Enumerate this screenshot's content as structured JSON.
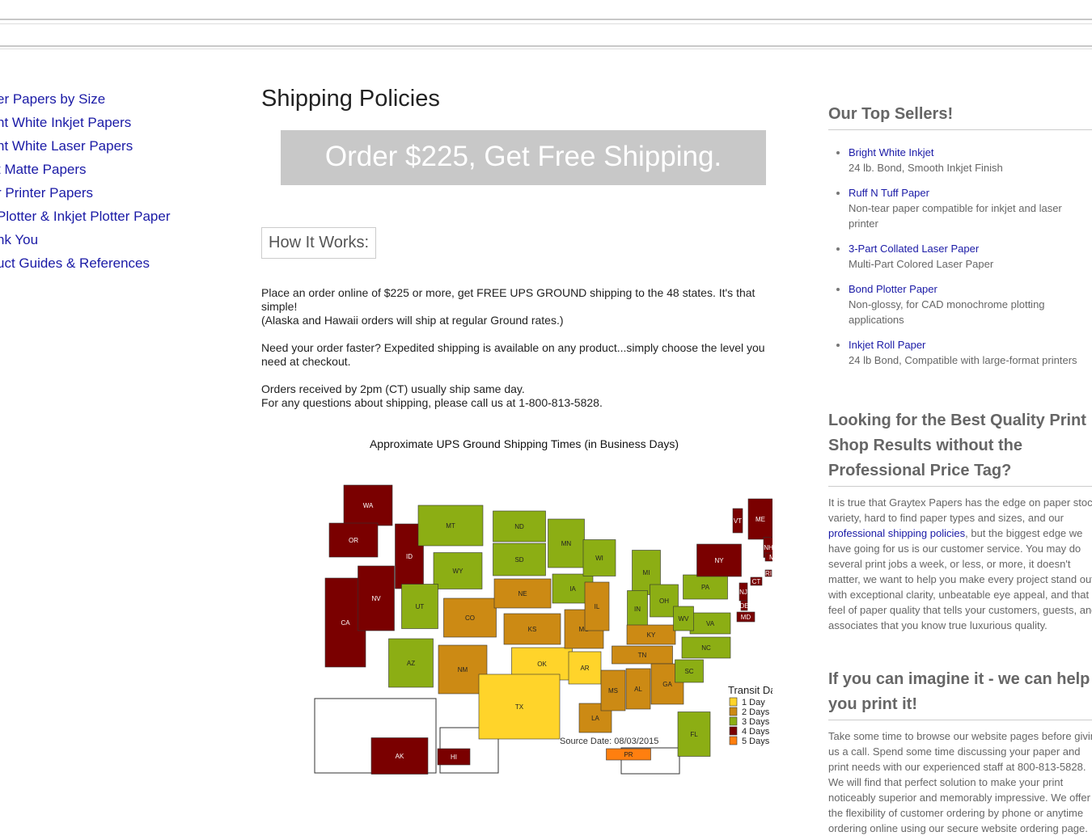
{
  "nav": {
    "items": [
      "er Papers by Size",
      "nt White Inkjet Papers",
      "nt White Laser Papers",
      "t Matte Papers",
      "r Printer Papers",
      "Plotter & Inkjet Plotter Paper",
      "nk You",
      "uct Guides & References"
    ]
  },
  "main": {
    "title": "Shipping Policies",
    "promo": "Order $225, Get Free Shipping.",
    "how_label": "How It Works:",
    "paragraphs": [
      [
        "Place an order online of $225 or more, get FREE UPS GROUND shipping to the 48 states. It's that simple!",
        "(Alaska and Hawaii orders will ship at regular Ground rates.)"
      ],
      [
        "Need your order faster? Expedited shipping is available on any product...simply choose the level you need at checkout."
      ],
      [
        "Orders received by 2pm (CT) usually ship same day.",
        "For any questions about shipping, please call us at 1-800-813-5828."
      ]
    ],
    "map": {
      "title": "Approximate UPS Ground Shipping Times (in Business Days)",
      "source": "Source Date: 08/03/2015",
      "legend_title": "Transit Days",
      "legend": [
        {
          "label": "1 Day",
          "color": "#ffd42a"
        },
        {
          "label": "2 Days",
          "color": "#cc8a14"
        },
        {
          "label": "3 Days",
          "color": "#8cae14"
        },
        {
          "label": "4 Days",
          "color": "#7a0000"
        },
        {
          "label": "5 Days",
          "color": "#ff7f0f"
        }
      ],
      "states": {
        "WA": 4,
        "OR": 4,
        "CA": 4,
        "NV": 4,
        "ID": 4,
        "MT": 3,
        "WY": 3,
        "UT": 3,
        "CO": 2,
        "AZ": 3,
        "NM": 2,
        "ND": 3,
        "SD": 3,
        "NE": 2,
        "KS": 2,
        "OK": 1,
        "TX": 1,
        "MN": 3,
        "IA": 3,
        "MO": 2,
        "AR": 1,
        "LA": 2,
        "WI": 3,
        "IL": 2,
        "MI": 3,
        "IN": 3,
        "OH": 3,
        "KY": 2,
        "TN": 2,
        "MS": 2,
        "AL": 2,
        "GA": 2,
        "FL": 3,
        "SC": 3,
        "NC": 3,
        "VA": 3,
        "WV": 3,
        "PA": 3,
        "NY": 4,
        "VT": 4,
        "ME": 4,
        "NH": 4,
        "MA": 4,
        "RI": 4,
        "CT": 4,
        "NJ": 4,
        "DE": 4,
        "MD": 4,
        "AK": 4,
        "HI": 4,
        "PR": 5
      }
    }
  },
  "side": {
    "top_title": "Our Top Sellers!",
    "top": [
      {
        "name": "Bright White Inkjet",
        "desc": "24 lb. Bond, Smooth Inkjet Finish"
      },
      {
        "name": "Ruff N Tuff Paper",
        "desc": "Non-tear paper compatible for inkjet and laser printer"
      },
      {
        "name": "3-Part Collated Laser Paper",
        "desc": "Multi-Part Colored Laser Paper"
      },
      {
        "name": "Bond Plotter Paper",
        "desc": "Non-glossy, for CAD monochrome plotting applications"
      },
      {
        "name": "Inkjet Roll Paper",
        "desc": "24 lb Bond, Compatible with large-format printers"
      }
    ],
    "h2": "Looking for the Best Quality Print Shop Results without the Professional Price Tag?",
    "p2a": "It is true that Graytex Papers has the edge on paper stock variety, hard to find paper types and sizes, and our ",
    "p2link": "professional shipping policies",
    "p2b": ", but the biggest edge we have going for us is our customer service. You may do several print jobs a week, or less, or more, it doesn't matter, we want to help you make every project stand out with exceptional clarity, unbeatable eye appeal, and that feel of paper quality that tells your customers, guests, and associates that you know true luxurious quality.",
    "h3": "If you can imagine it - we can help you print it!",
    "p3": "Take some time to browse our website pages before giving us a call. Spend some time discussing your paper and print needs with our experienced staff at 800-813-5828. We will find that perfect solution to make your print noticeably superior and memorably impressive. We offer the flexibility of customer ordering by phone or anytime ordering online using our secure website ordering page."
  }
}
